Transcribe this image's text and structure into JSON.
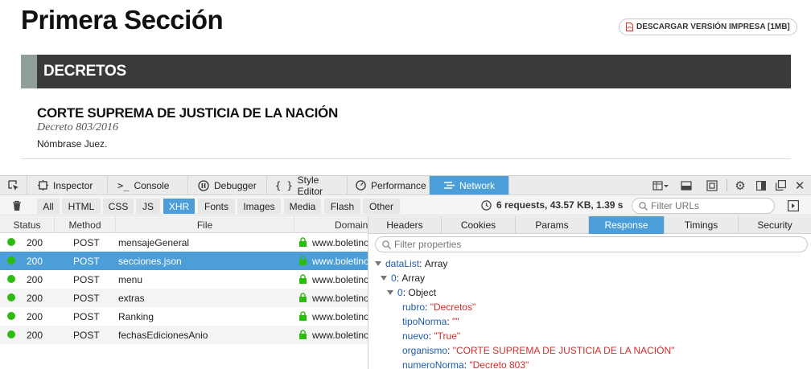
{
  "page": {
    "title": "Primera Sección",
    "download_label": "DESCARGAR VERSIÓN IMPRESA [1MB]",
    "section_label": "DECRETOS",
    "organism": "CORTE SUPREMA DE JUSTICIA DE LA NACIÓN",
    "decree": "Decreto 803/2016",
    "summary": "Nómbrase Juez."
  },
  "devtools": {
    "tools": [
      {
        "label": "Inspector"
      },
      {
        "label": "Console"
      },
      {
        "label": "Debugger"
      },
      {
        "label": "Style Editor"
      },
      {
        "label": "Performance"
      },
      {
        "label": "Network"
      }
    ],
    "filter_types": [
      "All",
      "HTML",
      "CSS",
      "JS",
      "XHR",
      "Fonts",
      "Images",
      "Media",
      "Flash",
      "Other"
    ],
    "active_filter": "XHR",
    "summary": "6 requests, 43.57 KB, 1.39 s",
    "filter_urls_placeholder": "Filter URLs",
    "columns": [
      "Status",
      "Method",
      "File",
      "Domain"
    ],
    "requests": [
      {
        "status": "200",
        "method": "POST",
        "file": "mensajeGeneral",
        "domain": "www.boletino"
      },
      {
        "status": "200",
        "method": "POST",
        "file": "secciones.json",
        "domain": "www.boletino"
      },
      {
        "status": "200",
        "method": "POST",
        "file": "menu",
        "domain": "www.boletino"
      },
      {
        "status": "200",
        "method": "POST",
        "file": "extras",
        "domain": "www.boletino"
      },
      {
        "status": "200",
        "method": "POST",
        "file": "Ranking",
        "domain": "www.boletino"
      },
      {
        "status": "200",
        "method": "POST",
        "file": "fechasEdicionesAnio",
        "domain": "www.boletino"
      }
    ],
    "detail_tabs": [
      "Headers",
      "Cookies",
      "Params",
      "Response",
      "Timings",
      "Security"
    ],
    "active_detail_tab": "Response",
    "filter_props_placeholder": "Filter properties",
    "response_tree": {
      "root_key": "dataList",
      "root_type": "Array",
      "item0_key": "0",
      "item0_type": "Array",
      "obj_key": "0",
      "obj_type": "Object",
      "fields": [
        {
          "key": "rubro",
          "value": "\"Decretos\""
        },
        {
          "key": "tipoNorma",
          "value": "\"\""
        },
        {
          "key": "nuevo",
          "value": "\"True\""
        },
        {
          "key": "organismo",
          "value": "\"CORTE SUPREMA DE JUSTICIA DE LA NACIÓN\""
        },
        {
          "key": "numeroNorma",
          "value": "\"Decreto 803\""
        }
      ]
    }
  },
  "colors": {
    "accent_blue": "#4c9ed9",
    "status_ok": "#2cbb0f",
    "section_bar": "#3a3a3a",
    "section_accent": "#8f9e96",
    "json_key": "#1f5ba8",
    "json_string": "#d02d2d"
  }
}
